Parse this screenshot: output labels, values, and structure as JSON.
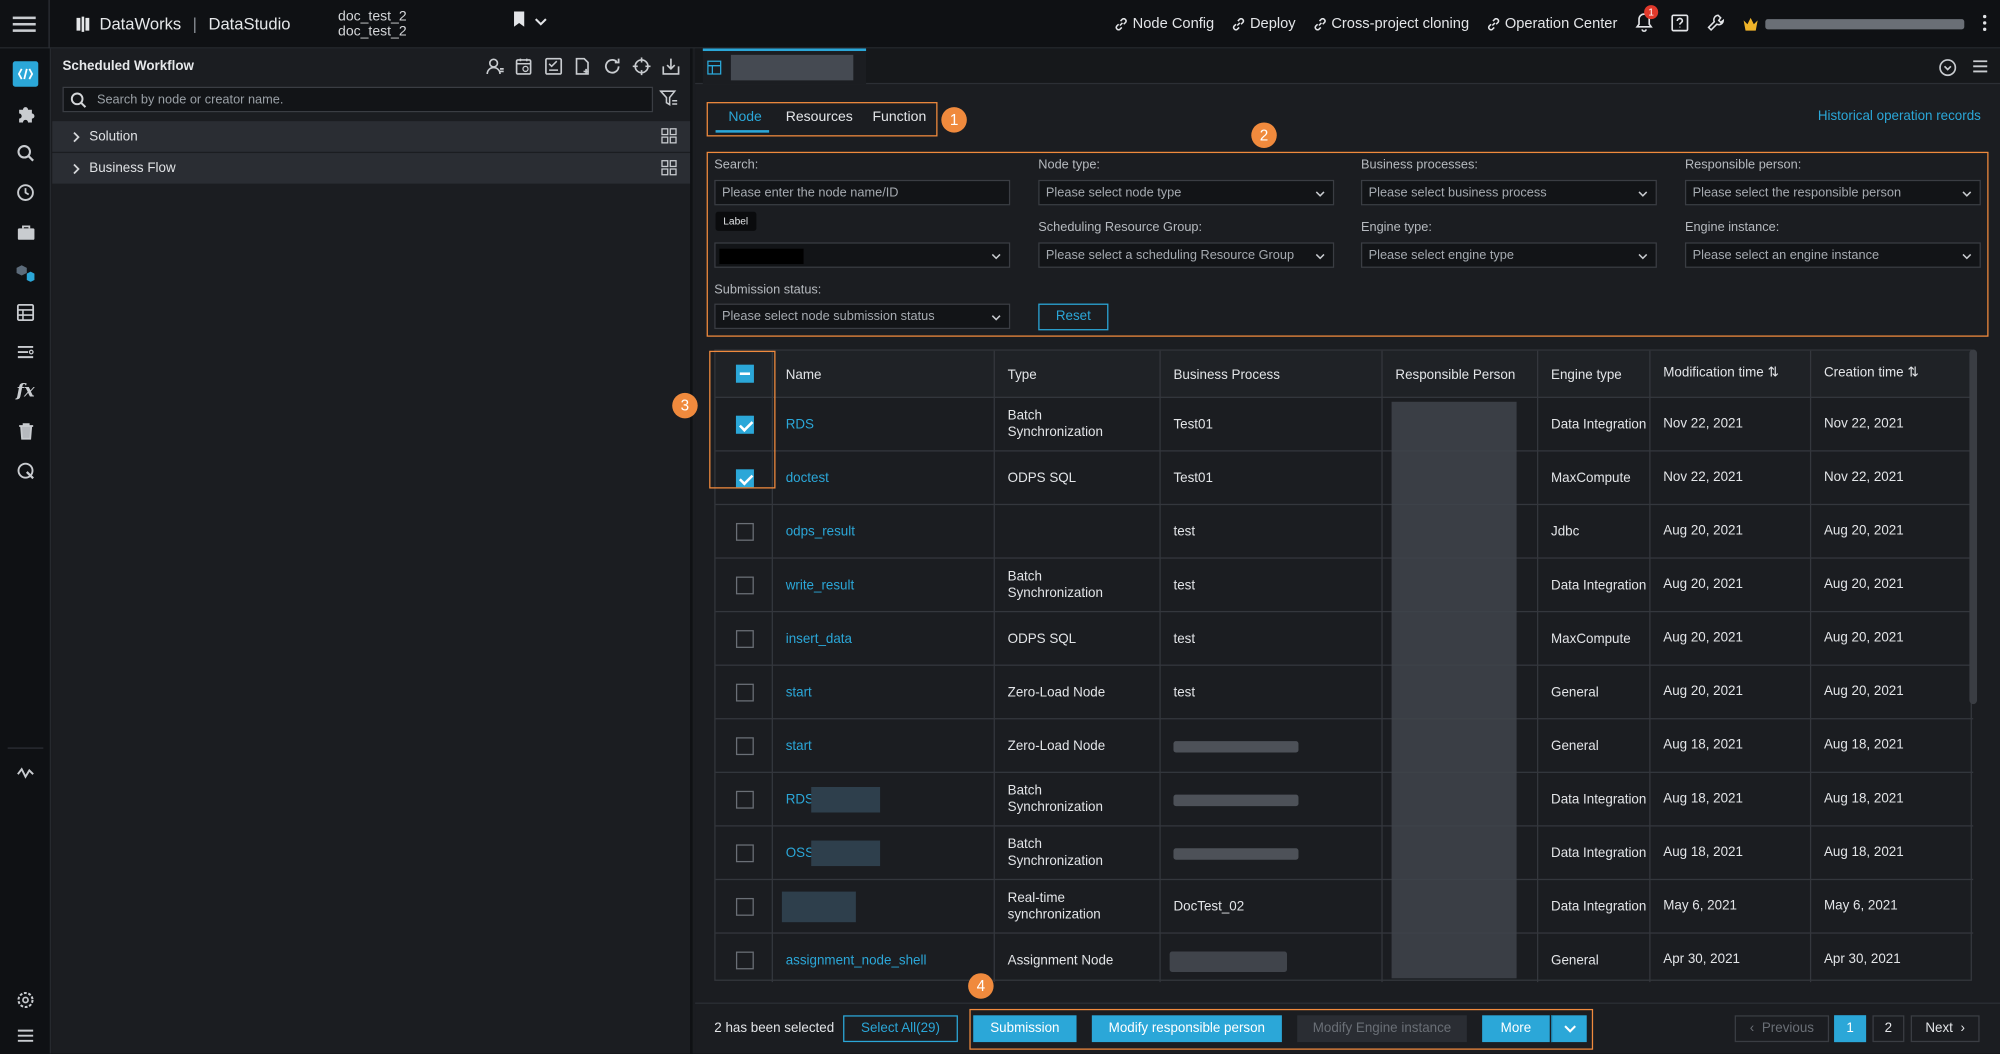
{
  "app": {
    "brand": "DataWorks",
    "module": "DataStudio",
    "project_line1": "doc_test_2",
    "project_line2": "doc_test_2"
  },
  "topnav": {
    "links": [
      "Node Config",
      "Deploy",
      "Cross-project cloning",
      "Operation Center"
    ],
    "notification_count": "1"
  },
  "explorer": {
    "title": "Scheduled Workflow",
    "search_placeholder": "Search by node or creator name.",
    "tree": [
      {
        "label": "Solution"
      },
      {
        "label": "Business Flow"
      }
    ]
  },
  "main": {
    "subtabs": [
      "Node",
      "Resources",
      "Function"
    ],
    "history_link": "Historical operation records",
    "badges": [
      "1",
      "2",
      "3",
      "4"
    ],
    "filters": {
      "search_label": "Search:",
      "search_placeholder": "Please enter the node name/ID",
      "node_type_label": "Node type:",
      "node_type_placeholder": "Please select node type",
      "business_label": "Business processes:",
      "business_placeholder": "Please select business process",
      "responsible_label": "Responsible person:",
      "responsible_placeholder": "Please select the responsible person",
      "label_tooltip": "Label",
      "scheduling_label": "Scheduling Resource Group:",
      "scheduling_placeholder": "Please select a scheduling Resource Group",
      "engine_type_label": "Engine type:",
      "engine_type_placeholder": "Please select engine type",
      "engine_instance_label": "Engine instance:",
      "engine_instance_placeholder": "Please select an engine instance",
      "submission_label": "Submission status:",
      "submission_placeholder": "Please select node submission status",
      "reset": "Reset"
    },
    "table": {
      "columns": [
        "Name",
        "Type",
        "Business Process",
        "Responsible Person",
        "Engine type",
        "Modification time",
        "Creation time"
      ],
      "rows": [
        {
          "checked": true,
          "name": "RDS",
          "type": [
            "Batch",
            "Synchronization"
          ],
          "process": "Test01",
          "engine": "Data Integration",
          "modified": "Nov 22, 2021",
          "created": "Nov 22, 2021"
        },
        {
          "checked": true,
          "name": "doctest",
          "type": [
            "ODPS SQL"
          ],
          "process": "Test01",
          "engine": "MaxCompute",
          "modified": "Nov 22, 2021",
          "created": "Nov 22, 2021"
        },
        {
          "checked": false,
          "name": "odps_result",
          "type": [],
          "process": "test",
          "engine": "Jdbc",
          "modified": "Aug 20, 2021",
          "created": "Aug 20, 2021"
        },
        {
          "checked": false,
          "name": "write_result",
          "type": [
            "Batch",
            "Synchronization"
          ],
          "process": "test",
          "engine": "Data Integration",
          "modified": "Aug 20, 2021",
          "created": "Aug 20, 2021"
        },
        {
          "checked": false,
          "name": "insert_data",
          "type": [
            "ODPS SQL"
          ],
          "process": "test",
          "engine": "MaxCompute",
          "modified": "Aug 20, 2021",
          "created": "Aug 20, 2021"
        },
        {
          "checked": false,
          "name": "start",
          "type": [
            "Zero-Load Node"
          ],
          "process": "test",
          "engine": "General",
          "modified": "Aug 20, 2021",
          "created": "Aug 20, 2021"
        },
        {
          "checked": false,
          "name": "start",
          "type": [
            "Zero-Load Node"
          ],
          "process": "",
          "engine": "General",
          "modified": "Aug 18, 2021",
          "created": "Aug 18, 2021"
        },
        {
          "checked": false,
          "name": "RDS_",
          "type": [
            "Batch",
            "Synchronization"
          ],
          "process": "",
          "engine": "Data Integration",
          "modified": "Aug 18, 2021",
          "created": "Aug 18, 2021"
        },
        {
          "checked": false,
          "name": "OSS_",
          "type": [
            "Batch",
            "Synchronization"
          ],
          "process": "",
          "engine": "Data Integration",
          "modified": "Aug 18, 2021",
          "created": "Aug 18, 2021"
        },
        {
          "checked": false,
          "name": "",
          "type": [
            "Real-time",
            "synchronization"
          ],
          "process": "DocTest_02",
          "engine": "Data Integration",
          "modified": "May 6, 2021",
          "created": "May 6, 2021"
        },
        {
          "checked": false,
          "name": "assignment_node_shell",
          "type": [
            "Assignment Node"
          ],
          "process": "",
          "engine": "General",
          "modified": "Apr 30, 2021",
          "created": "Apr 30, 2021"
        }
      ]
    },
    "footer": {
      "selected_text": "2 has been selected",
      "select_all": "Select All(29)",
      "submission": "Submission",
      "modify_person": "Modify responsible person",
      "modify_engine": "Modify Engine instance",
      "more": "More",
      "previous": "Previous",
      "page1": "1",
      "page2": "2",
      "next": "Next"
    }
  },
  "colors": {
    "accent": "#2ba7d8",
    "highlight": "#f08a3d",
    "background": "#1b1d21"
  }
}
